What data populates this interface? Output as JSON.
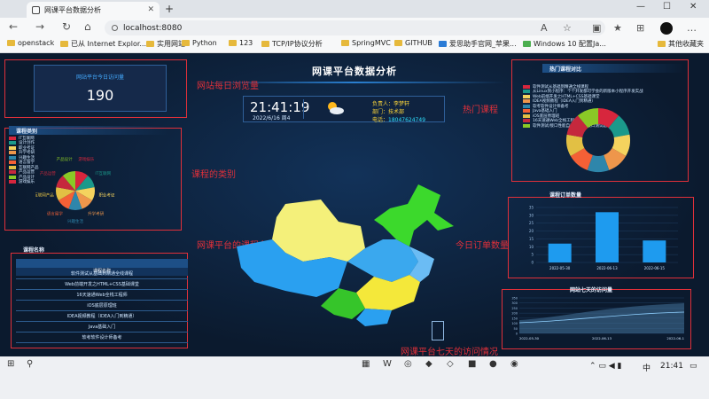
{
  "browser": {
    "tab_title": "网课平台数据分析",
    "url": "localhost:8080",
    "new_tab": "+",
    "win_min": "—",
    "win_max": "☐",
    "win_close": "✕"
  },
  "bookmarks": [
    "openstack",
    "已从 Internet Explor...",
    "实用网站",
    "Python",
    "123",
    "TCP/IP协议分析",
    "SpringMVC",
    "GITHUB",
    "爱思助手官网_苹果...",
    "Windows 10 配置Ja...",
    "其他收藏夹"
  ],
  "dashboard": {
    "title": "网课平台数据分析",
    "visits": {
      "label": "网站平台今日访问量",
      "value": "190"
    },
    "time": "21:41:19",
    "date": "2022/6/16 周4",
    "leader": {
      "label": "负责人：",
      "name": "李梦轩",
      "dept_label": "部门：",
      "dept": "技术部",
      "tel_label": "电话：",
      "tel": "18047624749"
    },
    "category_panel": {
      "title": "课程类别",
      "legend": [
        "IT互联网",
        "设计创作",
        "职业考证",
        "升学考研",
        "兴趣生活",
        "语言留学",
        "互联网产品",
        "产品运营",
        "产品设计",
        "游戏娱乐"
      ],
      "pie_labels": [
        "游戏娱乐",
        "IT互联网",
        "职业考证",
        "升学考研",
        "兴趣生活",
        "语言留学",
        "互联网产品",
        "产品运营",
        "产品设计"
      ]
    },
    "course_list": {
      "title": "课程名称",
      "column": "课程名称",
      "rows": [
        "软件测试从基础到精通全线课程",
        "Web前端开发之HTML+CSS基础课堂",
        "16天速通Web全栈工程师",
        "iOS底层原理班",
        "IDEA视频教程（IDEA入门到精通）",
        "Java基础入门",
        "软考软件设计师备考"
      ]
    },
    "hot_panel": {
      "title": "热门课程对比",
      "legend": [
        "软件测试从基础到精通全线课程",
        "从Linux到小程序：个个开发都可学会的新版本小程序开发实战",
        "Web前端开发之HTML+CSS基础课堂",
        "IDEA视频教程（IDEA入门到精通）",
        "软考软件设计师备考",
        "Java基础入门",
        "iOS底层原理班",
        "16天速通Web全栈工程师",
        "软件测试/接口性能自动化测试/接口测试题"
      ]
    },
    "orders_panel": {
      "title": "课程订单数量"
    },
    "visits7_panel": {
      "title": "网站七天的访问量"
    }
  },
  "annotations": {
    "daily": "网站每日浏览量",
    "category": "课程的类别",
    "names": "网课平台的课程名",
    "hot": "热门课程",
    "orders": "今日订单数量",
    "visits7": "网课平台七天的访问情况"
  },
  "chart_data": [
    {
      "type": "bar",
      "title": "课程订单数量",
      "categories": [
        "2022-05-30",
        "2022-06-13",
        "2022-06-15"
      ],
      "values": [
        12,
        32,
        14
      ],
      "ylim": [
        0,
        35
      ],
      "yticks": [
        0,
        5,
        10,
        15,
        20,
        25,
        30,
        35
      ]
    },
    {
      "type": "area",
      "title": "网站七天的访问量",
      "x": [
        "2022-05-30",
        "2022-06-13",
        "2022-06-1"
      ],
      "yticks": [
        0,
        50,
        100,
        150,
        200,
        250,
        300,
        350
      ]
    },
    {
      "type": "pie",
      "title": "热门课程对比",
      "colors": [
        "#d7263d",
        "#1b998b",
        "#f4d35e",
        "#ee964b",
        "#2e86ab",
        "#f46036",
        "#e2c044",
        "#c5283d",
        "#8ac926"
      ]
    }
  ],
  "taskbar": {
    "clock": "21:41",
    "lang": "中"
  }
}
